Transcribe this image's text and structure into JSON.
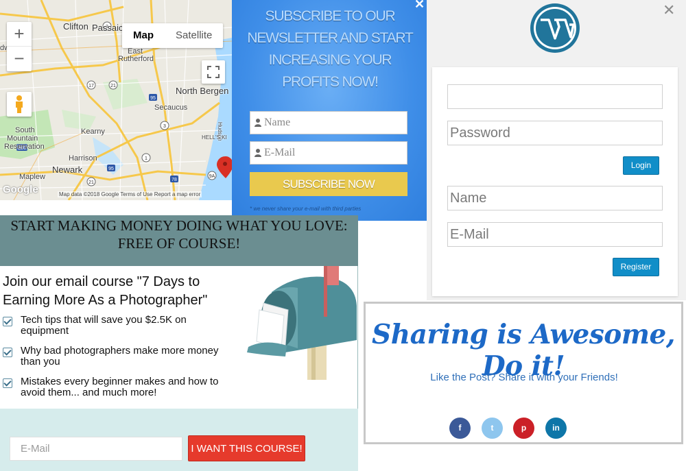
{
  "map": {
    "toggle": {
      "map_label": "Map",
      "satellite_label": "Satellite"
    },
    "zoom_in": "+",
    "zoom_out": "−",
    "places": [
      "Clifton",
      "Passaic",
      "dwel",
      "East",
      "Rutherford",
      "North Bergen",
      "Secaucus",
      "South",
      "Mountain",
      "Reservation",
      "Kearny",
      "Harrison",
      "Newark",
      "Maplew",
      "Hudson",
      "HELL'S KI"
    ],
    "route_badges": [
      "3",
      "17",
      "21",
      "95",
      "3",
      "280",
      "95",
      "21",
      "78",
      "9A",
      "1"
    ],
    "footer": "Map data ©2018 Google    Terms of Use    Report a map error",
    "logo": "Google",
    "colors": {
      "land": "#eceae2",
      "water": "#aadaff",
      "highway": "#f6c84b",
      "park": "#c3e6b6",
      "pin": "#d93025"
    }
  },
  "newsletter": {
    "title": "SUBSCRIBE TO OUR NEWSLETTER AND START INCREASING YOUR PROFITS NOW!",
    "close": "✕",
    "name_placeholder": "Name",
    "email_placeholder": "E-Mail",
    "button": "SUBSCRIBE NOW",
    "note": "* we never share your e-mail with third parties",
    "colors": {
      "bg": "#3f8ee8",
      "button": "#e9c94e"
    }
  },
  "wordpress": {
    "close": "✕",
    "username_value": "",
    "password_placeholder": "Password",
    "login_button": "Login",
    "name_placeholder": "Name",
    "email_placeholder": "E-Mail",
    "register_button": "Register",
    "colors": {
      "button": "#118ec8",
      "logo": "#21759b"
    }
  },
  "course": {
    "heading": "START MAKING MONEY DOING WHAT YOU LOVE: FREE OF COURSE!",
    "lead": "Join our email course \"7 Days to Earning More As a Photographer\"",
    "items": [
      "Tech tips that will save you $2.5K on equipment",
      "Why bad photographers make more money than you",
      "Mistakes every beginner makes and how to avoid them... and much more!"
    ],
    "email_placeholder": "E-Mail",
    "button": "I WANT THIS COURSE!",
    "colors": {
      "header": "#6b8e91",
      "footer": "#d6ecec",
      "button": "#e63a2c"
    }
  },
  "share": {
    "title": "Sharing is Awesome, Do it!",
    "subtitle": "Like the Post? Share it with your Friends!",
    "buttons": [
      {
        "icon": "facebook-icon",
        "glyph": "f",
        "color": "#3b5998"
      },
      {
        "icon": "twitter-icon",
        "glyph": "t",
        "color": "#8ec6ee"
      },
      {
        "icon": "pinterest-icon",
        "glyph": "p",
        "color": "#cb2027"
      },
      {
        "icon": "linkedin-icon",
        "glyph": "in",
        "color": "#0e76a8"
      }
    ]
  }
}
